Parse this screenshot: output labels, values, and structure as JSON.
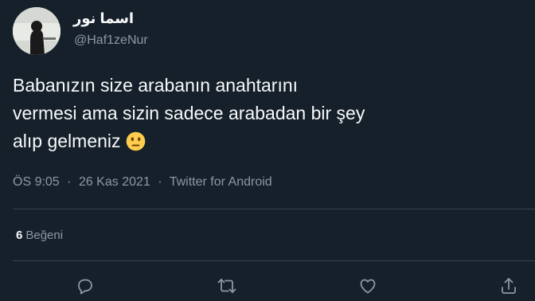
{
  "user": {
    "display_name": "اسما نور",
    "handle": "@Haf1zeNur"
  },
  "tweet": {
    "lines": [
      "Babanızın size arabanın anahtarını",
      "vermesi ama sizin sadece arabadan bir şey",
      "alıp gelmeniz"
    ],
    "emoji": "neutral-face-emoji",
    "time": "ÖS 9:05",
    "date": "26 Kas 2021",
    "separator": "·",
    "source": "Twitter for Android"
  },
  "stats": {
    "likes_count": "6",
    "likes_label": "Beğeni"
  },
  "actions": [
    "reply-icon",
    "retweet-icon",
    "like-icon",
    "share-icon"
  ],
  "colors": {
    "background": "#15202b",
    "text": "#f7f9f9",
    "secondary": "#8b98a5",
    "divider": "#38444d",
    "emoji": "#ffcc4d"
  }
}
